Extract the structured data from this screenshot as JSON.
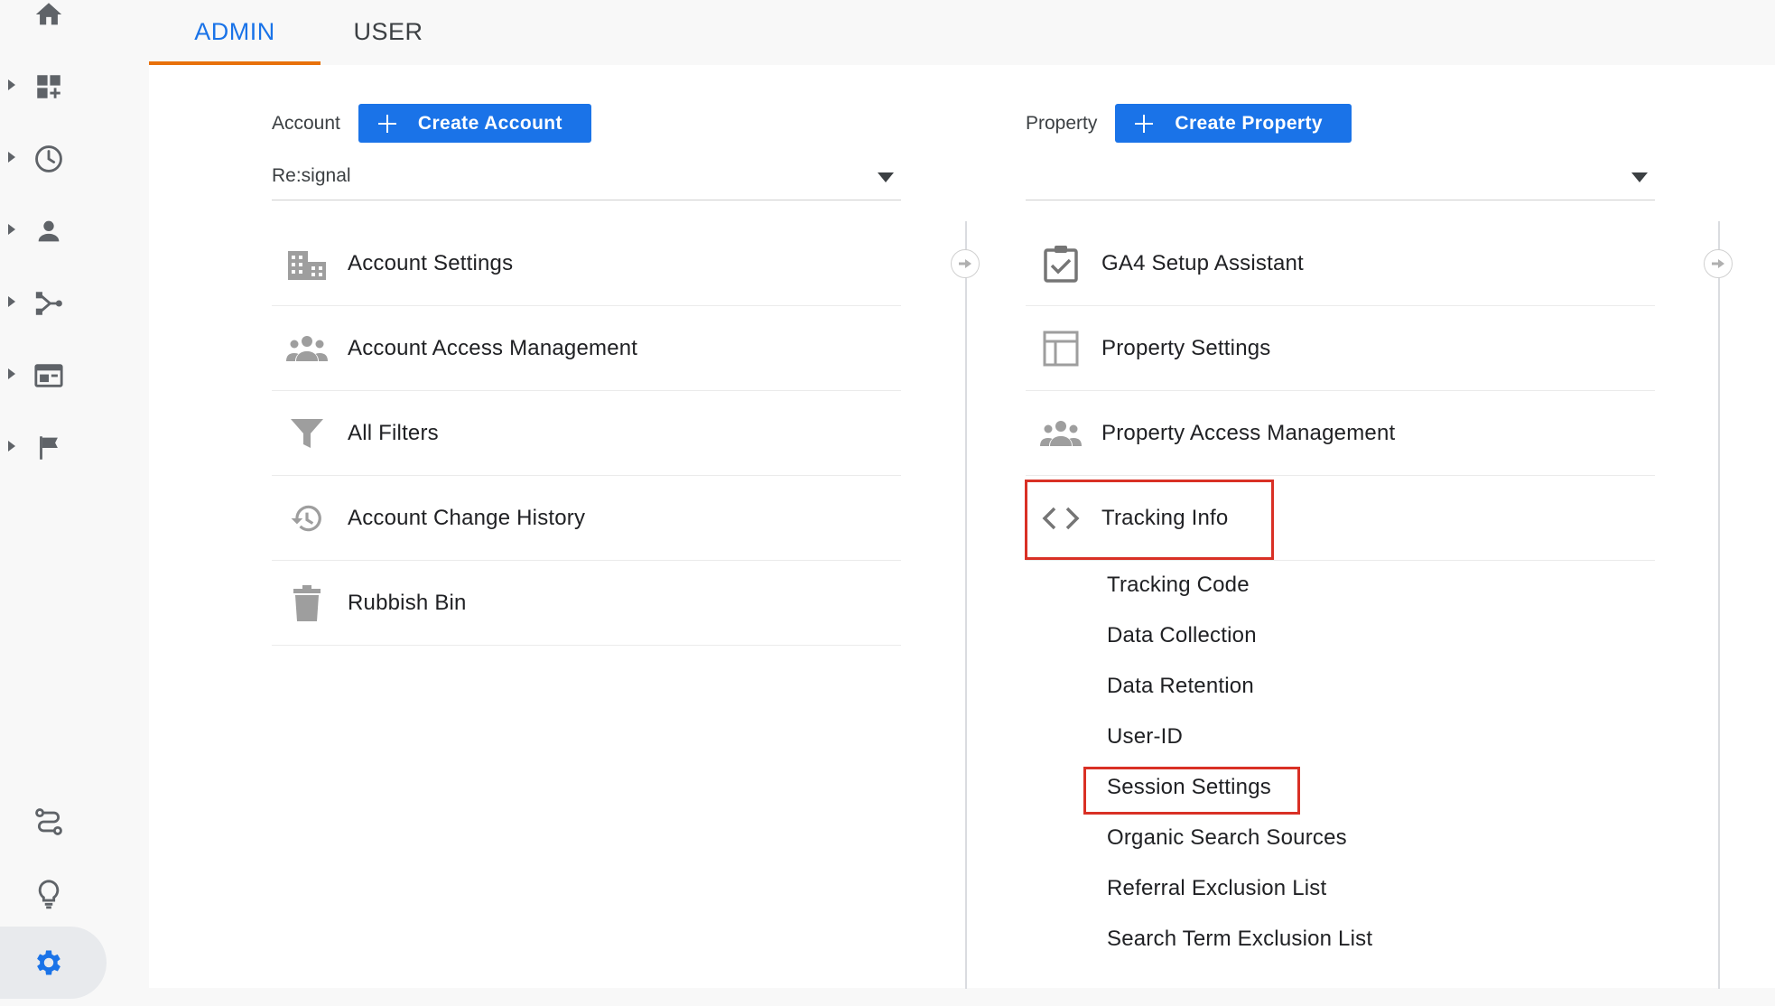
{
  "tabs": {
    "admin": "ADMIN",
    "user": "USER"
  },
  "account": {
    "label": "Account",
    "create_button": "Create Account",
    "selected": "Re:signal",
    "items": [
      {
        "label": "Account Settings",
        "icon": "building-icon"
      },
      {
        "label": "Account Access Management",
        "icon": "people-icon"
      },
      {
        "label": "All Filters",
        "icon": "filter-icon"
      },
      {
        "label": "Account Change History",
        "icon": "history-icon"
      },
      {
        "label": "Rubbish Bin",
        "icon": "trash-icon"
      }
    ]
  },
  "property": {
    "label": "Property",
    "create_button": "Create Property",
    "selected": "",
    "items": [
      {
        "label": "GA4 Setup Assistant",
        "icon": "checklist-icon"
      },
      {
        "label": "Property Settings",
        "icon": "layout-icon"
      },
      {
        "label": "Property Access Management",
        "icon": "people-icon"
      },
      {
        "label": "Tracking Info",
        "icon": "code-icon"
      }
    ],
    "tracking_subitems": [
      "Tracking Code",
      "Data Collection",
      "Data Retention",
      "User-ID",
      "Session Settings",
      "Organic Search Sources",
      "Referral Exclusion List",
      "Search Term Exclusion List"
    ]
  },
  "colors": {
    "accent": "#1a73e8",
    "tab_underline": "#e8710a",
    "highlight": "#d93025",
    "icon_gray": "#5f6368"
  },
  "sidebar_icons": [
    "home-icon",
    "dashboard-icon",
    "clock-icon",
    "person-icon",
    "acquisition-icon",
    "behavior-icon",
    "flag-icon",
    "path-icon",
    "lightbulb-icon",
    "gear-icon"
  ]
}
